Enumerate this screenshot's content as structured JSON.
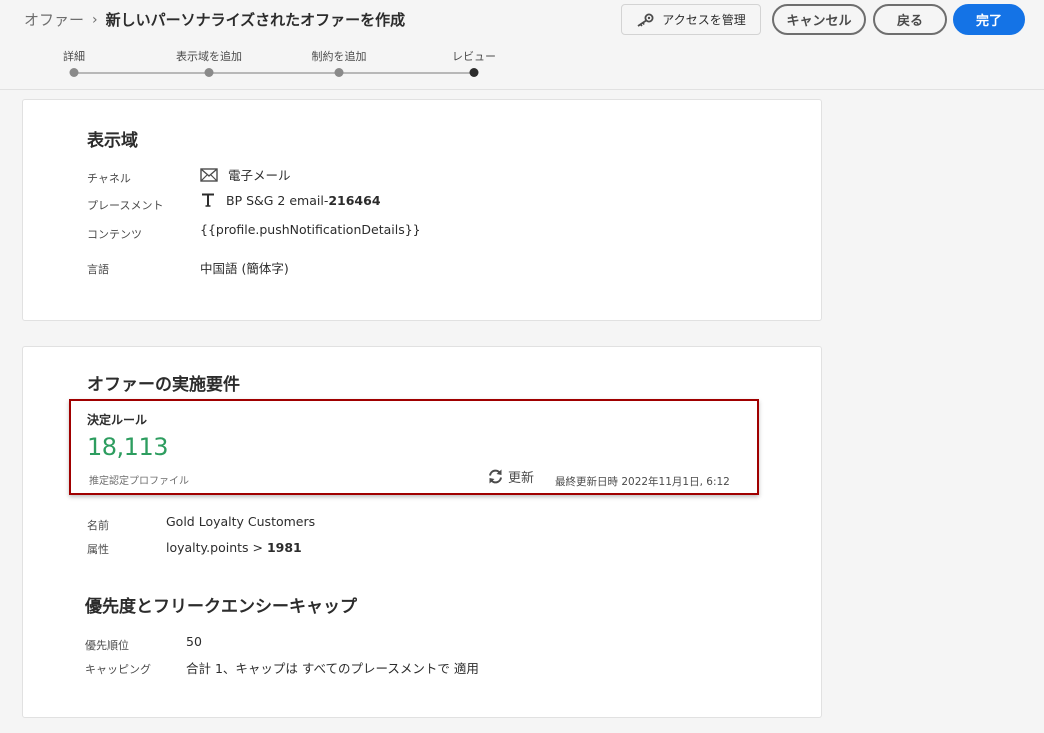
{
  "header": {
    "breadcrumb_root": "オファー",
    "breadcrumb_sep": "›",
    "title": "新しいパーソナライズされたオファーを作成",
    "manage_access_label": "アクセスを管理",
    "cancel_label": "キャンセル",
    "back_label": "戻る",
    "done_label": "完了"
  },
  "stepper": {
    "steps": [
      "詳細",
      "表示域を追加",
      "制約を追加",
      "レビュー"
    ],
    "active_index": 3
  },
  "placement_section": {
    "title": "表示域",
    "channel_label": "チャネル",
    "channel_value": "電子メール",
    "placement_label": "プレースメント",
    "placement_value": "BP S&G 2 email-",
    "placement_id": "216464",
    "content_label": "コンテンツ",
    "content_value": "{{profile.pushNotificationDetails}}",
    "language_label": "言語",
    "language_value": "中国語 (簡体字)"
  },
  "eligibility_section": {
    "title": "オファーの実施要件",
    "rule_title": "決定ルール",
    "rule_count": "18,113",
    "rule_sub": "推定認定プロファイル",
    "refresh_label": "更新",
    "updated_text": "最終更新日時 2022年11月1日, 6:12",
    "name_label": "名前",
    "name_value": "Gold Loyalty Customers",
    "attribute_label": "属性",
    "attribute_value": "loyalty.points > ",
    "attribute_threshold": "1981"
  },
  "priority_section": {
    "title": "優先度とフリークエンシーキャップ",
    "priority_label": "優先順位",
    "priority_value": "50",
    "capping_label": "キャッピング",
    "capping_value": "合計 1、キャップは すべてのプレースメントで 適用"
  },
  "colors": {
    "accent": "#1473e6",
    "highlight_border": "#a00000",
    "count_green": "#2d9d5f"
  }
}
